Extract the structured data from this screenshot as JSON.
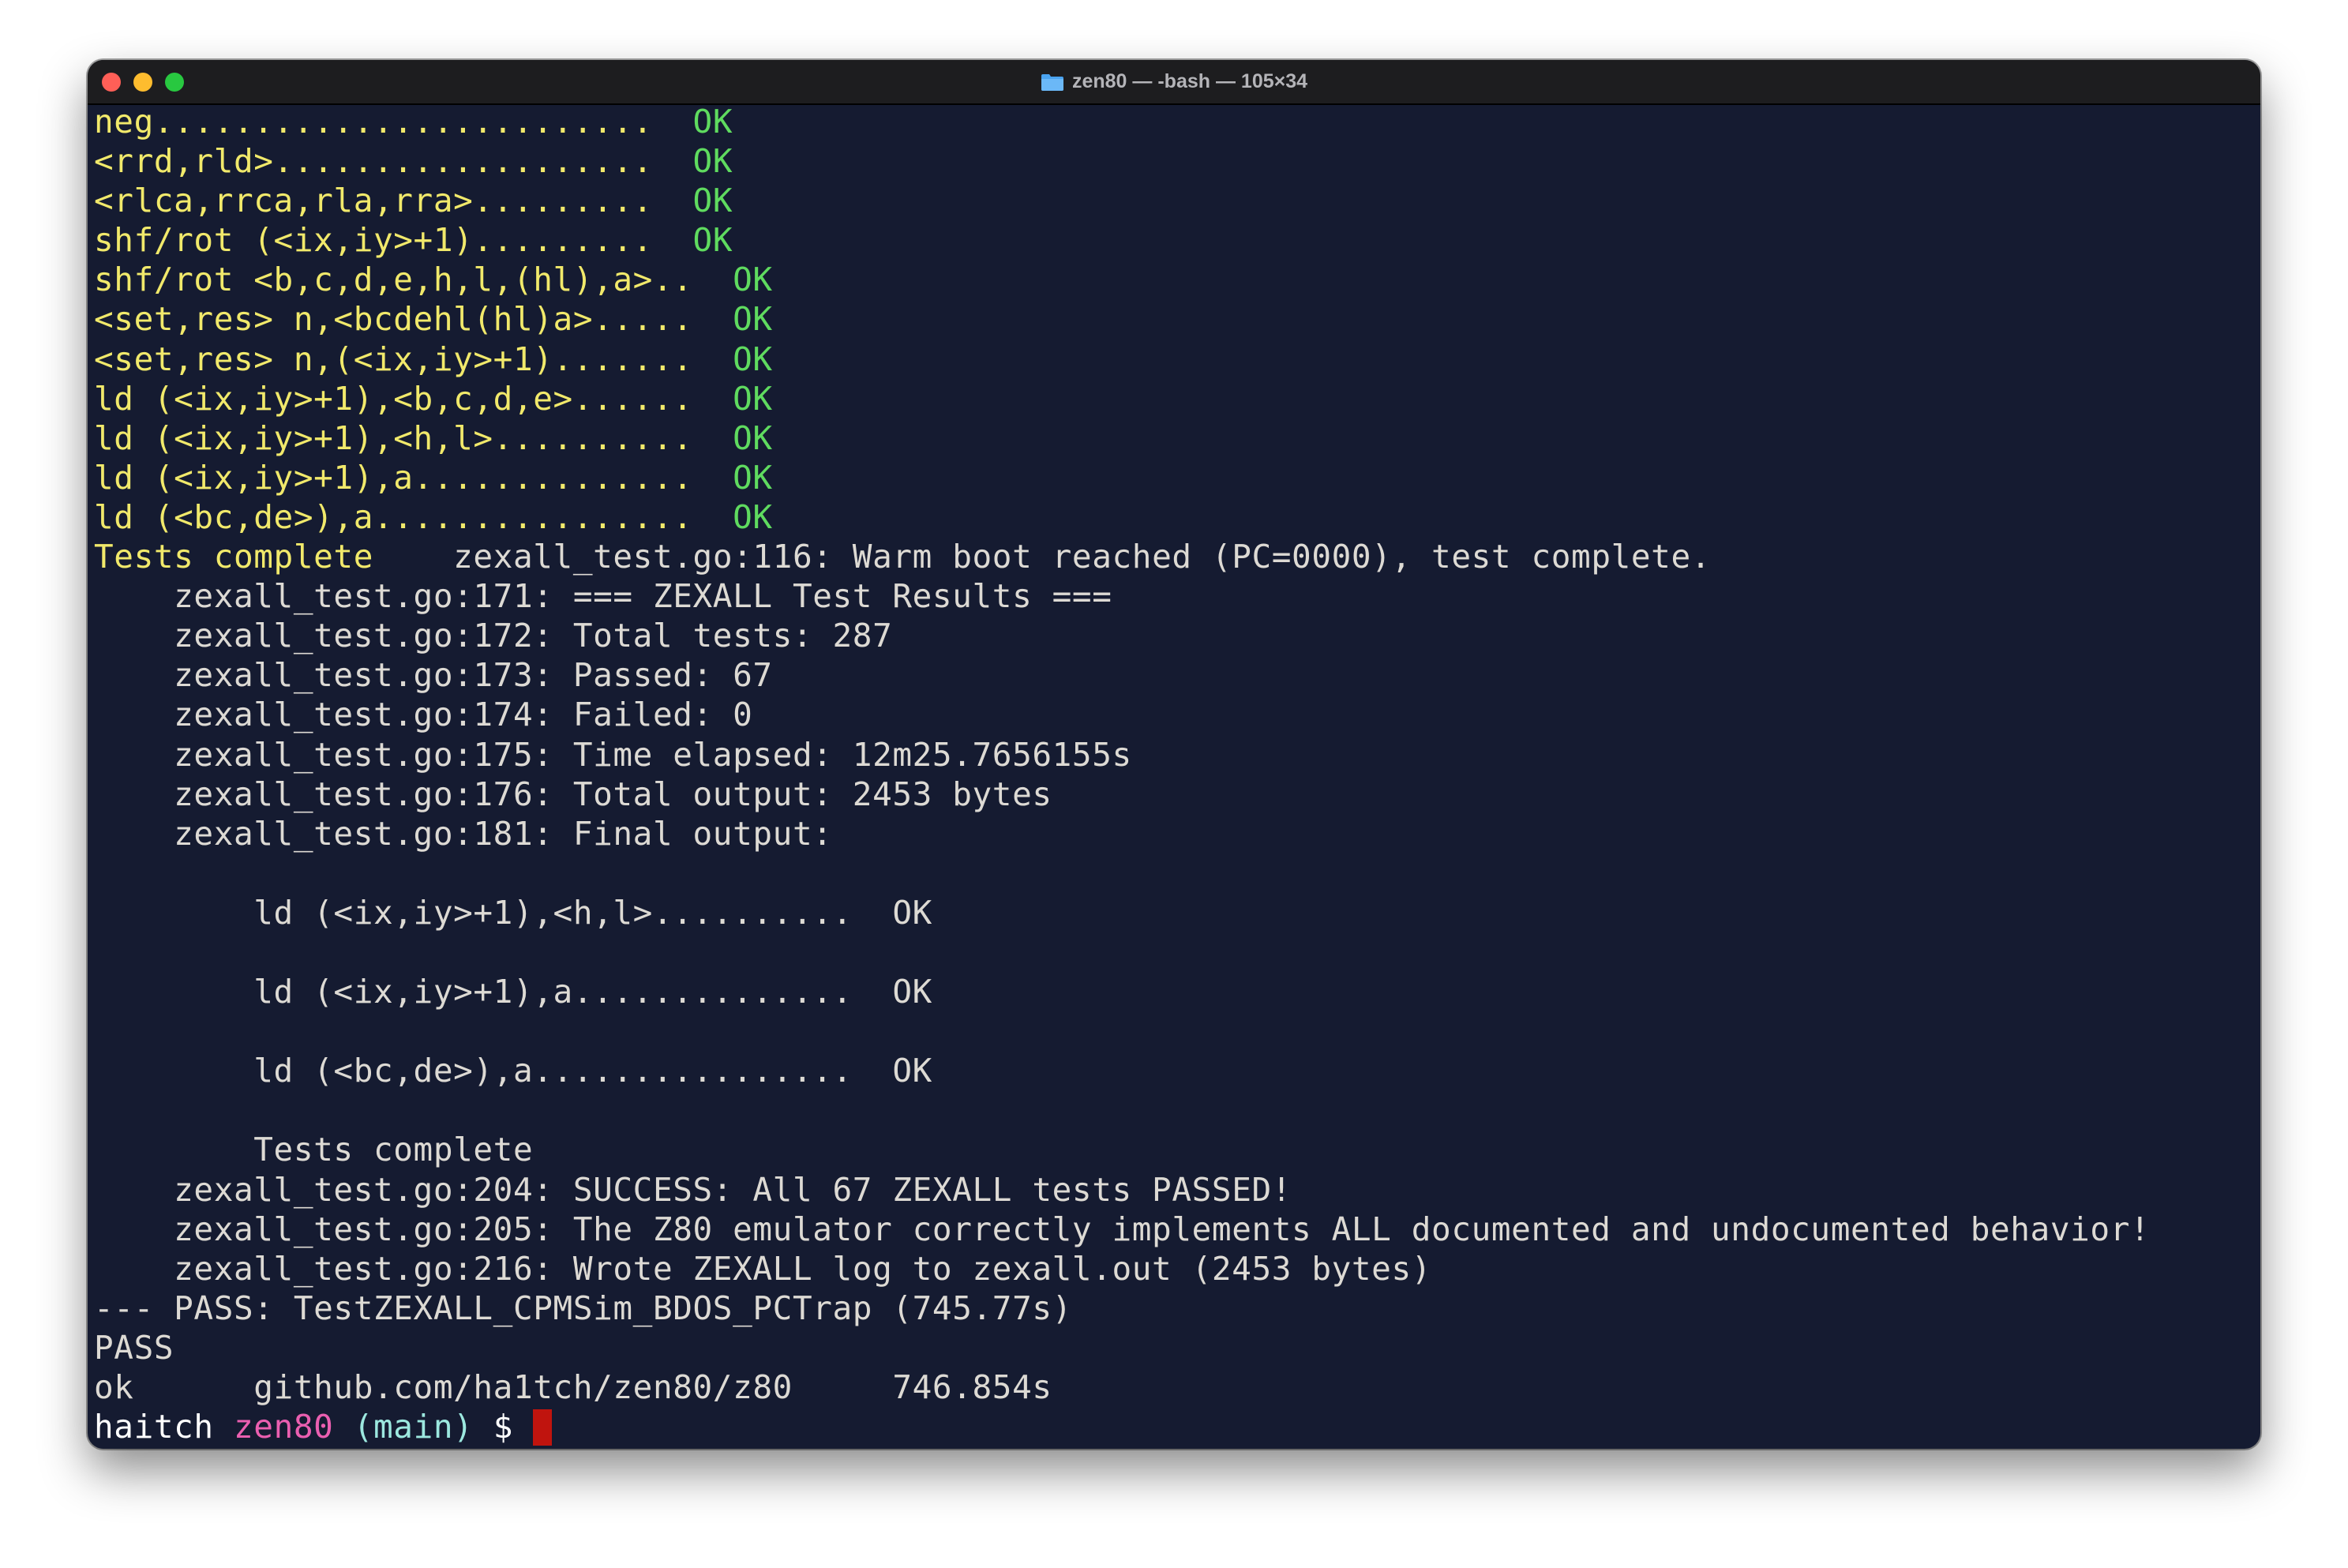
{
  "window": {
    "title": "zen80 — -bash — 105×34",
    "title_icon": "folder-icon",
    "colors": {
      "background": "#151b31",
      "yellow": "#f1e96b",
      "green": "#5fdb5f",
      "plain": "#dddad4",
      "pink": "#ea5fb0",
      "cyan": "#9ce8df",
      "cursor": "#c0140e"
    }
  },
  "terminal": {
    "lines": [
      {
        "segments": [
          {
            "text": "neg.........................  ",
            "color": "yellow"
          },
          {
            "text": "OK",
            "color": "green"
          }
        ]
      },
      {
        "segments": [
          {
            "text": "<rrd,rld>...................  ",
            "color": "yellow"
          },
          {
            "text": "OK",
            "color": "green"
          }
        ]
      },
      {
        "segments": [
          {
            "text": "<rlca,rrca,rla,rra>.........  ",
            "color": "yellow"
          },
          {
            "text": "OK",
            "color": "green"
          }
        ]
      },
      {
        "segments": [
          {
            "text": "shf/rot (<ix,iy>+1).........  ",
            "color": "yellow"
          },
          {
            "text": "OK",
            "color": "green"
          }
        ]
      },
      {
        "segments": [
          {
            "text": "shf/rot <b,c,d,e,h,l,(hl),a>..  ",
            "color": "yellow"
          },
          {
            "text": "OK",
            "color": "green"
          }
        ]
      },
      {
        "segments": [
          {
            "text": "<set,res> n,<bcdehl(hl)a>.....  ",
            "color": "yellow"
          },
          {
            "text": "OK",
            "color": "green"
          }
        ]
      },
      {
        "segments": [
          {
            "text": "<set,res> n,(<ix,iy>+1).......  ",
            "color": "yellow"
          },
          {
            "text": "OK",
            "color": "green"
          }
        ]
      },
      {
        "segments": [
          {
            "text": "ld (<ix,iy>+1),<b,c,d,e>......  ",
            "color": "yellow"
          },
          {
            "text": "OK",
            "color": "green"
          }
        ]
      },
      {
        "segments": [
          {
            "text": "ld (<ix,iy>+1),<h,l>..........  ",
            "color": "yellow"
          },
          {
            "text": "OK",
            "color": "green"
          }
        ]
      },
      {
        "segments": [
          {
            "text": "ld (<ix,iy>+1),a..............  ",
            "color": "yellow"
          },
          {
            "text": "OK",
            "color": "green"
          }
        ]
      },
      {
        "segments": [
          {
            "text": "ld (<bc,de>),a................  ",
            "color": "yellow"
          },
          {
            "text": "OK",
            "color": "green"
          }
        ]
      },
      {
        "segments": [
          {
            "text": "Tests complete",
            "color": "yellow"
          },
          {
            "text": "    zexall_test.go:116: Warm boot reached (PC=0000), test complete.",
            "color": "plain"
          }
        ]
      },
      {
        "segments": [
          {
            "text": "    zexall_test.go:171: === ZEXALL Test Results ===",
            "color": "plain"
          }
        ]
      },
      {
        "segments": [
          {
            "text": "    zexall_test.go:172: Total tests: 287",
            "color": "plain"
          }
        ]
      },
      {
        "segments": [
          {
            "text": "    zexall_test.go:173: Passed: 67",
            "color": "plain"
          }
        ]
      },
      {
        "segments": [
          {
            "text": "    zexall_test.go:174: Failed: 0",
            "color": "plain"
          }
        ]
      },
      {
        "segments": [
          {
            "text": "    zexall_test.go:175: Time elapsed: 12m25.7656155s",
            "color": "plain"
          }
        ]
      },
      {
        "segments": [
          {
            "text": "    zexall_test.go:176: Total output: 2453 bytes",
            "color": "plain"
          }
        ]
      },
      {
        "segments": [
          {
            "text": "    zexall_test.go:181: Final output:",
            "color": "plain"
          }
        ]
      },
      {
        "segments": []
      },
      {
        "segments": [
          {
            "text": "        ld (<ix,iy>+1),<h,l>..........  OK",
            "color": "plain"
          }
        ]
      },
      {
        "segments": []
      },
      {
        "segments": [
          {
            "text": "        ld (<ix,iy>+1),a..............  OK",
            "color": "plain"
          }
        ]
      },
      {
        "segments": []
      },
      {
        "segments": [
          {
            "text": "        ld (<bc,de>),a................  OK",
            "color": "plain"
          }
        ]
      },
      {
        "segments": []
      },
      {
        "segments": [
          {
            "text": "        Tests complete",
            "color": "plain"
          }
        ]
      },
      {
        "segments": [
          {
            "text": "    zexall_test.go:204: SUCCESS: All 67 ZEXALL tests PASSED!",
            "color": "plain"
          }
        ]
      },
      {
        "segments": [
          {
            "text": "    zexall_test.go:205: The Z80 emulator correctly implements ALL documented and undocumented behavior!",
            "color": "plain"
          }
        ]
      },
      {
        "segments": [
          {
            "text": "    zexall_test.go:216: Wrote ZEXALL log to zexall.out (2453 bytes)",
            "color": "plain"
          }
        ]
      },
      {
        "segments": [
          {
            "text": "--- PASS: TestZEXALL_CPMSim_BDOS_PCTrap (745.77s)",
            "color": "plain"
          }
        ]
      },
      {
        "segments": [
          {
            "text": "PASS",
            "color": "plain"
          }
        ]
      },
      {
        "segments": [
          {
            "text": "ok      github.com/ha1tch/zen80/z80     746.854s",
            "color": "plain"
          }
        ]
      }
    ],
    "prompt": {
      "user": "haitch",
      "directory": "zen80",
      "branch": "(main)",
      "symbol": "$"
    }
  }
}
